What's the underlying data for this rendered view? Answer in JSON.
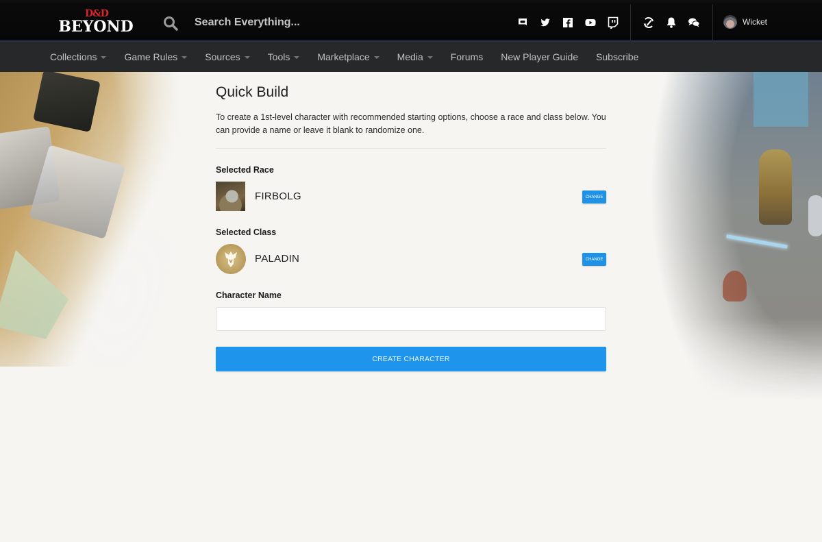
{
  "header": {
    "logo": {
      "top": "D&D",
      "bottom": "BEYOND"
    },
    "search": {
      "placeholder": "Search Everything...",
      "value": ""
    },
    "social_icons": [
      "discord-icon",
      "twitter-icon",
      "facebook-icon",
      "youtube-icon",
      "twitch-icon"
    ],
    "utility_icons": [
      "character-sync-icon",
      "notifications-icon",
      "messages-icon"
    ],
    "user": {
      "name": "Wicket"
    }
  },
  "nav": {
    "items": [
      {
        "label": "Collections",
        "dropdown": true
      },
      {
        "label": "Game Rules",
        "dropdown": true
      },
      {
        "label": "Sources",
        "dropdown": true
      },
      {
        "label": "Tools",
        "dropdown": true
      },
      {
        "label": "Marketplace",
        "dropdown": true
      },
      {
        "label": "Media",
        "dropdown": true
      },
      {
        "label": "Forums",
        "dropdown": false
      },
      {
        "label": "New Player Guide",
        "dropdown": false
      },
      {
        "label": "Subscribe",
        "dropdown": false
      }
    ]
  },
  "main": {
    "title": "Quick Build",
    "intro": "To create a 1st-level character with recommended starting options, choose a race and class below. You can provide a name or leave it blank to randomize one.",
    "race": {
      "label": "Selected Race",
      "value": "FIRBOLG",
      "change_label": "CHANGE"
    },
    "class": {
      "label": "Selected Class",
      "value": "PALADIN",
      "change_label": "CHANGE"
    },
    "character_name": {
      "label": "Character Name",
      "value": "",
      "placeholder": ""
    },
    "create_label": "CREATE CHARACTER"
  },
  "colors": {
    "accent": "#1f94ec",
    "header_bg": "#070707",
    "nav_bg": "#26282a",
    "brand_red": "#d7262c"
  }
}
